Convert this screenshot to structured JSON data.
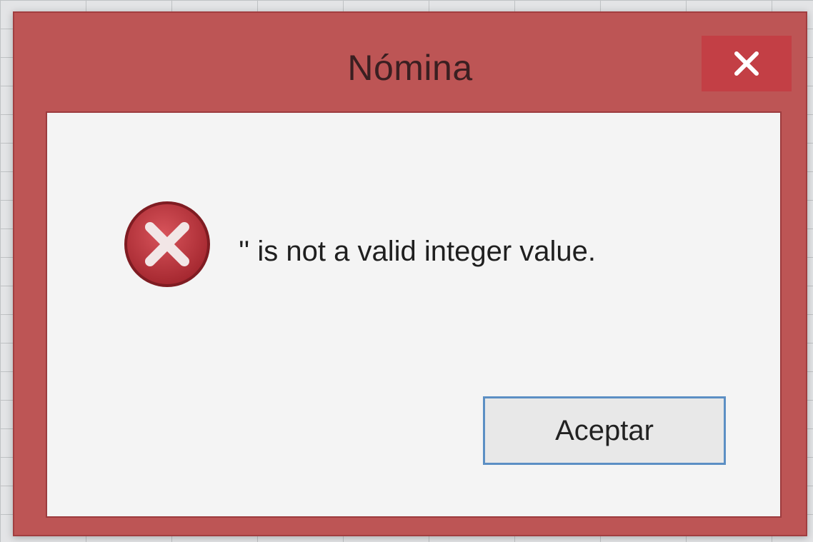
{
  "dialog": {
    "title": "Nómina",
    "message": "'' is not a valid integer value.",
    "ok_label": "Aceptar",
    "icons": {
      "close": "close-icon",
      "error": "error-icon"
    },
    "colors": {
      "frame": "#bd5555",
      "close_button": "#c33f45",
      "client_bg": "#f4f4f4",
      "error_icon": "#b8323a",
      "button_border": "#5c8fc4"
    }
  }
}
